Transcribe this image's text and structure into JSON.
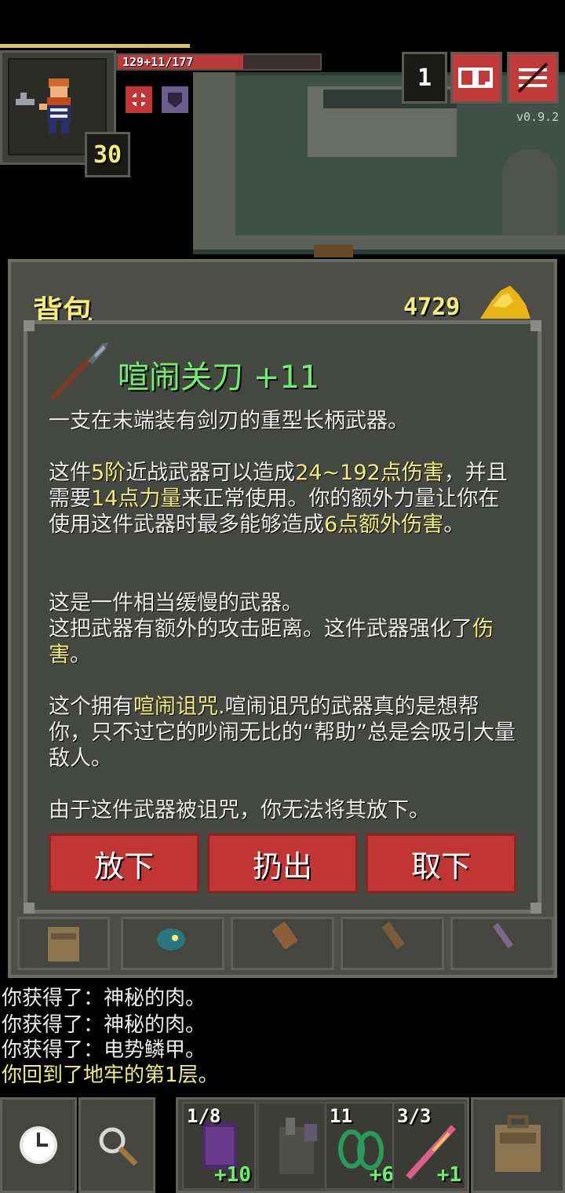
{
  "hud": {
    "hp_text": "129+11/177",
    "hero_level": "30",
    "depth": "1",
    "version": "v0.9.2"
  },
  "backpack": {
    "title": "背包",
    "gold": "4729"
  },
  "item": {
    "name": "喧闹关刀 +11",
    "desc_intro": "一支在末端装有剑刃的重型长柄武器。",
    "p1_a": "这件",
    "p1_tier": "5阶",
    "p1_b": "近战武器可以造成",
    "p1_dmg": "24~192点伤害",
    "p1_c": "，并且需要",
    "p1_str": "14点力量",
    "p1_d": "来正常使用。你的额外力量让你在使用这件武器时最多能够造成",
    "p1_extra": "6点额外伤害",
    "p1_e": "。",
    "p2_line1": "这是一件相当缓慢的武器。",
    "p2_line2a": "这把武器有额外的攻击距离。这件武器强化了",
    "p2_hl": "伤害",
    "p2_line2b": "。",
    "p3_a": "这个拥有",
    "p3_hl": "喧闹诅咒",
    "p3_b": ".喧闹诅咒的武器真的是想帮你，只不过它的吵闹无比的“帮助”总是会吸引大量敌人。",
    "p4": "由于这件武器被诅咒，你无法将其放下。",
    "buttons": [
      "放下",
      "扔出",
      "取下"
    ]
  },
  "log": [
    "你获得了：神秘的肉。",
    "你获得了：神秘的肉。",
    "你获得了：电势鳞甲。",
    "你回到了地牢的第1层。"
  ],
  "log_highlight_color": "#f3ed7a",
  "quickslots": [
    {
      "top": "1/8",
      "bottom": "+10",
      "icon": "purple-book-icon"
    },
    {
      "top": "",
      "bottom": "",
      "icon": "locked-item-icon"
    },
    {
      "top": "11",
      "bottom": "+6",
      "icon": "green-chain-icon"
    },
    {
      "top": "3/3",
      "bottom": "+1",
      "icon": "magic-wand-icon"
    }
  ],
  "colors": {
    "accent_red": "#c23535",
    "title_green": "#6df06d",
    "highlight_yellow": "#f3ed7a"
  }
}
